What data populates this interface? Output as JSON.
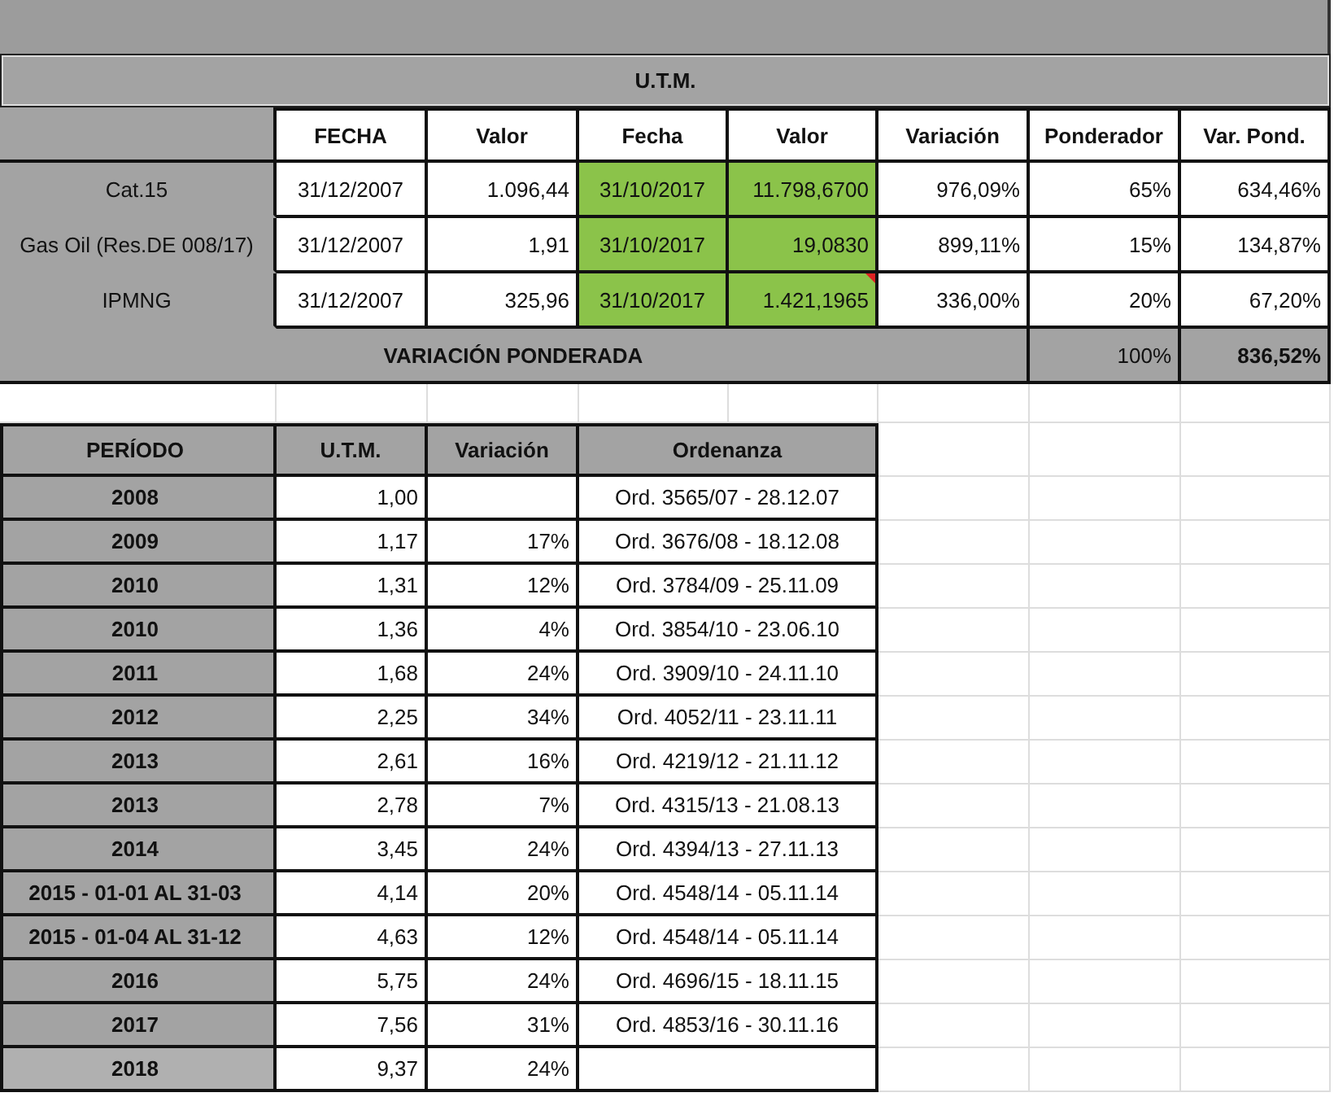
{
  "title": "U.T.M.",
  "top_table": {
    "columns": [
      {
        "label": "FECHA",
        "highlighted": false
      },
      {
        "label": "Valor",
        "highlighted": false
      },
      {
        "label": "Fecha",
        "highlighted": true
      },
      {
        "label": "Valor",
        "highlighted": true
      },
      {
        "label": "Variación",
        "highlighted": false
      },
      {
        "label": "Ponderador",
        "highlighted": false
      },
      {
        "label": "Var. Pond.",
        "highlighted": false
      }
    ],
    "rows": [
      {
        "label": "Cat.15",
        "cells": [
          {
            "text": "31/12/2007",
            "comment": false
          },
          {
            "text": "1.096,44",
            "comment": false
          },
          {
            "text": "31/10/2017",
            "comment": false
          },
          {
            "text": "11.798,6700",
            "comment": false
          },
          {
            "text": "976,09%",
            "comment": false
          },
          {
            "text": "65%",
            "comment": false
          },
          {
            "text": "634,46%",
            "comment": false
          }
        ]
      },
      {
        "label": "Gas Oil (Res.DE 008/17)",
        "cells": [
          {
            "text": "31/12/2007",
            "comment": false
          },
          {
            "text": "1,91",
            "comment": false
          },
          {
            "text": "31/10/2017",
            "comment": false
          },
          {
            "text": "19,0830",
            "comment": false
          },
          {
            "text": "899,11%",
            "comment": false
          },
          {
            "text": "15%",
            "comment": false
          },
          {
            "text": "134,87%",
            "comment": false
          }
        ]
      },
      {
        "label": "IPMNG",
        "cells": [
          {
            "text": "31/12/2007",
            "comment": false
          },
          {
            "text": "325,96",
            "comment": false
          },
          {
            "text": "31/10/2017",
            "comment": false
          },
          {
            "text": "1.421,1965",
            "comment": true
          },
          {
            "text": "336,00%",
            "comment": false
          },
          {
            "text": "20%",
            "comment": false
          },
          {
            "text": "67,20%",
            "comment": false
          }
        ]
      }
    ],
    "total": {
      "label": "VARIACIÓN PONDERADA",
      "weight": "100%",
      "value": "836,52%"
    }
  },
  "periods_table": {
    "columns": [
      "PERÍODO",
      "U.T.M.",
      "Variación",
      "Ordenanza"
    ],
    "rows": [
      {
        "period": "2008",
        "utm": "1,00",
        "variation": "",
        "ordinance": "Ord. 3565/07 - 28.12.07"
      },
      {
        "period": "2009",
        "utm": "1,17",
        "variation": "17%",
        "ordinance": "Ord. 3676/08 - 18.12.08"
      },
      {
        "period": "2010",
        "utm": "1,31",
        "variation": "12%",
        "ordinance": "Ord. 3784/09 - 25.11.09"
      },
      {
        "period": "2010",
        "utm": "1,36",
        "variation": "4%",
        "ordinance": "Ord. 3854/10 - 23.06.10"
      },
      {
        "period": "2011",
        "utm": "1,68",
        "variation": "24%",
        "ordinance": "Ord. 3909/10 - 24.11.10"
      },
      {
        "period": "2012",
        "utm": "2,25",
        "variation": "34%",
        "ordinance": "Ord. 4052/11 - 23.11.11"
      },
      {
        "period": "2013",
        "utm": "2,61",
        "variation": "16%",
        "ordinance": "Ord. 4219/12 - 21.11.12"
      },
      {
        "period": "2013",
        "utm": "2,78",
        "variation": "7%",
        "ordinance": "Ord. 4315/13 - 21.08.13"
      },
      {
        "period": "2014",
        "utm": "3,45",
        "variation": "24%",
        "ordinance": "Ord. 4394/13 - 27.11.13"
      },
      {
        "period": "2015 - 01-01 AL 31-03",
        "utm": "4,14",
        "variation": "20%",
        "ordinance": "Ord. 4548/14 - 05.11.14"
      },
      {
        "period": "2015 - 01-04 AL 31-12",
        "utm": "4,63",
        "variation": "12%",
        "ordinance": "Ord. 4548/14 - 05.11.14"
      },
      {
        "period": "2016",
        "utm": "5,75",
        "variation": "24%",
        "ordinance": "Ord. 4696/15 - 18.11.15"
      },
      {
        "period": "2017",
        "utm": "7,56",
        "variation": "31%",
        "ordinance": "Ord. 4853/16 - 30.11.16"
      },
      {
        "period": "2018",
        "utm": "9,37",
        "variation": "24%",
        "ordinance": ""
      }
    ]
  }
}
